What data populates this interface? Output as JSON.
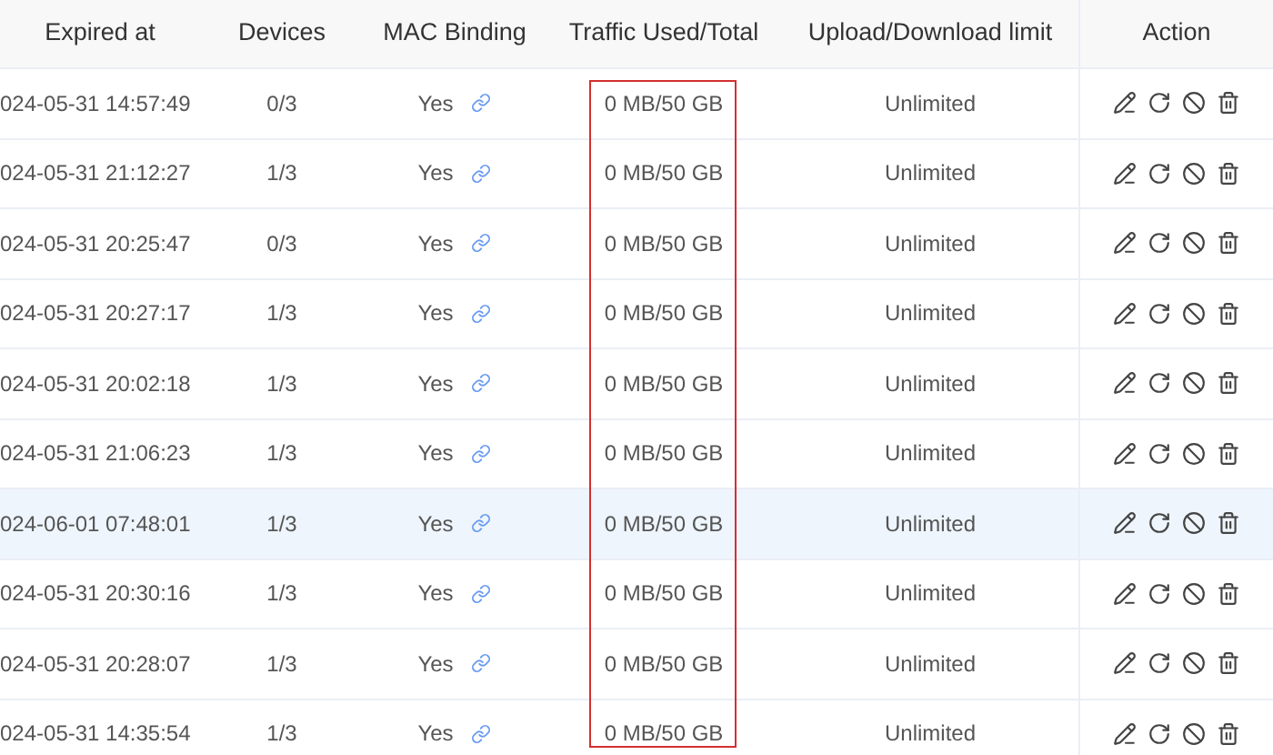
{
  "table": {
    "columns": [
      {
        "label": "Expired at"
      },
      {
        "label": "Devices"
      },
      {
        "label": "MAC Binding"
      },
      {
        "label": "Traffic Used/Total"
      },
      {
        "label": "Upload/Download limit"
      },
      {
        "label": "Action"
      }
    ],
    "traffic_column_framed": true,
    "rows": [
      {
        "expired": "024-05-31 14:57:49",
        "devices": "0/3",
        "mac": "Yes",
        "traffic": "0 MB/50 GB",
        "limit": "Unlimited",
        "highlighted": false
      },
      {
        "expired": "024-05-31 21:12:27",
        "devices": "1/3",
        "mac": "Yes",
        "traffic": "0 MB/50 GB",
        "limit": "Unlimited",
        "highlighted": false
      },
      {
        "expired": "024-05-31 20:25:47",
        "devices": "0/3",
        "mac": "Yes",
        "traffic": "0 MB/50 GB",
        "limit": "Unlimited",
        "highlighted": false
      },
      {
        "expired": "024-05-31 20:27:17",
        "devices": "1/3",
        "mac": "Yes",
        "traffic": "0 MB/50 GB",
        "limit": "Unlimited",
        "highlighted": false
      },
      {
        "expired": "024-05-31 20:02:18",
        "devices": "1/3",
        "mac": "Yes",
        "traffic": "0 MB/50 GB",
        "limit": "Unlimited",
        "highlighted": false
      },
      {
        "expired": "024-05-31 21:06:23",
        "devices": "1/3",
        "mac": "Yes",
        "traffic": "0 MB/50 GB",
        "limit": "Unlimited",
        "highlighted": false
      },
      {
        "expired": "024-06-01 07:48:01",
        "devices": "1/3",
        "mac": "Yes",
        "traffic": "0 MB/50 GB",
        "limit": "Unlimited",
        "highlighted": true
      },
      {
        "expired": "024-05-31 20:30:16",
        "devices": "1/3",
        "mac": "Yes",
        "traffic": "0 MB/50 GB",
        "limit": "Unlimited",
        "highlighted": false
      },
      {
        "expired": "024-05-31 20:28:07",
        "devices": "1/3",
        "mac": "Yes",
        "traffic": "0 MB/50 GB",
        "limit": "Unlimited",
        "highlighted": false
      },
      {
        "expired": "024-05-31 14:35:54",
        "devices": "1/3",
        "mac": "Yes",
        "traffic": "0 MB/50 GB",
        "limit": "Unlimited",
        "highlighted": false
      }
    ]
  }
}
